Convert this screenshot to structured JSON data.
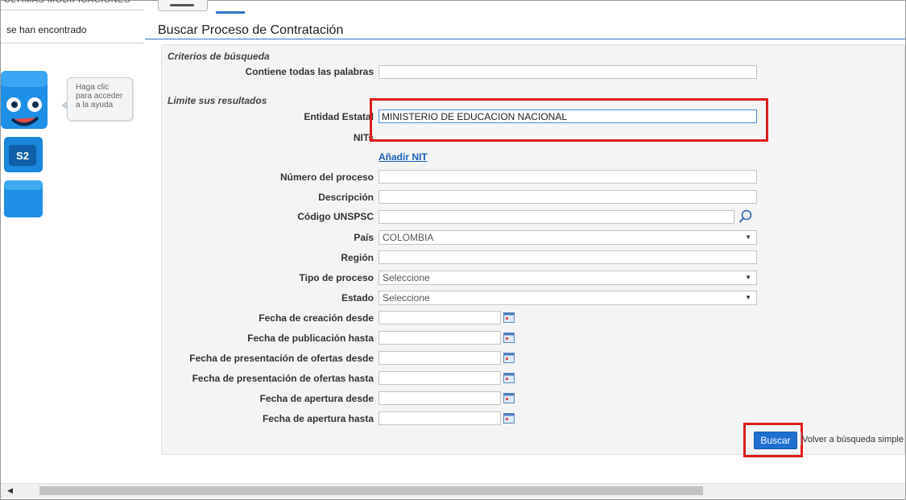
{
  "left_panel": {
    "top_text": "ÚLTIMAS MODIFICACIONES",
    "no_results_text": "se han encontrado",
    "help_bubble": [
      "Haga clic",
      "para acceder",
      "a la ayuda"
    ],
    "mascot_badge": "S2"
  },
  "page": {
    "title": "Buscar Proceso de Contratación"
  },
  "criteria": {
    "section_title": "Criterios de búsqueda",
    "all_words_label": "Contiene todas las palabras",
    "all_words_value": ""
  },
  "limits": {
    "section_title": "Limite sus resultados",
    "entity_label": "Entidad Estatal",
    "entity_value": "MINISTERIO DE EDUCACION NACIONAL",
    "nits_label": "NITs",
    "add_nit_link": "Añadir NIT",
    "process_number_label": "Número del proceso",
    "description_label": "Descripción",
    "unspsc_label": "Código UNSPSC",
    "country_label": "País",
    "country_value": "COLOMBIA",
    "region_label": "Región",
    "process_type_label": "Tipo de proceso",
    "process_type_value": "Seleccione",
    "status_label": "Estado",
    "status_value": "Seleccione",
    "created_from_label": "Fecha de creación desde",
    "published_until_label": "Fecha de publicación hasta",
    "offers_from_label": "Fecha de presentación de ofertas desde",
    "offers_until_label": "Fecha de presentación de ofertas hasta",
    "opening_from_label": "Fecha de apertura desde",
    "opening_until_label": "Fecha de apertura hasta"
  },
  "actions": {
    "search_button": "Buscar",
    "back_simple_link": "Volver a búsqueda simple"
  },
  "colors": {
    "accent": "#1f6fd1",
    "highlight": "#e01b1b",
    "title_rule": "#2f77c7"
  }
}
